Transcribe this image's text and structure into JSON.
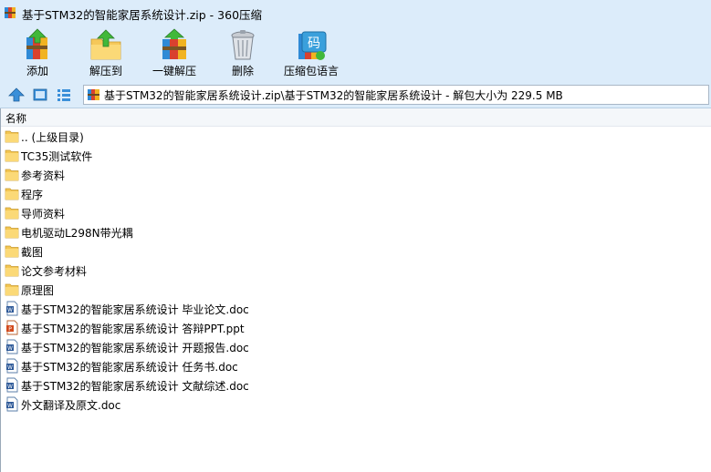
{
  "window": {
    "title": "基于STM32的智能家居系统设计.zip - 360压缩"
  },
  "toolbar": {
    "buttons": [
      {
        "label": "添加",
        "icon": "add-archive-icon"
      },
      {
        "label": "解压到",
        "icon": "extract-to-icon"
      },
      {
        "label": "一键解压",
        "icon": "one-click-extract-icon"
      },
      {
        "label": "删除",
        "icon": "trash-can-icon"
      },
      {
        "label": "压缩包语言",
        "icon": "archive-language-icon"
      }
    ],
    "lang_badge": "码"
  },
  "address": {
    "path": "基于STM32的智能家居系统设计.zip\\基于STM32的智能家居系统设计 - 解包大小为 229.5 MB"
  },
  "list": {
    "header_name": "名称",
    "items": [
      {
        "name": ".. (上级目录)",
        "type": "folder"
      },
      {
        "name": "TC35测试软件",
        "type": "folder"
      },
      {
        "name": "参考资料",
        "type": "folder"
      },
      {
        "name": "程序",
        "type": "folder"
      },
      {
        "name": "导师资料",
        "type": "folder"
      },
      {
        "name": "电机驱动L298N带光耦",
        "type": "folder"
      },
      {
        "name": "截图",
        "type": "folder"
      },
      {
        "name": "论文参考材料",
        "type": "folder"
      },
      {
        "name": "原理图",
        "type": "folder"
      },
      {
        "name": "基于STM32的智能家居系统设计 毕业论文.doc",
        "type": "doc"
      },
      {
        "name": "基于STM32的智能家居系统设计 答辩PPT.ppt",
        "type": "ppt"
      },
      {
        "name": "基于STM32的智能家居系统设计 开题报告.doc",
        "type": "doc"
      },
      {
        "name": "基于STM32的智能家居系统设计 任务书.doc",
        "type": "doc"
      },
      {
        "name": "基于STM32的智能家居系统设计 文献综述.doc",
        "type": "doc"
      },
      {
        "name": "外文翻译及原文.doc",
        "type": "doc"
      }
    ]
  }
}
